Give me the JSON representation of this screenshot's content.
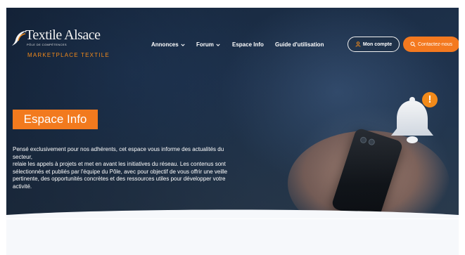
{
  "brand": {
    "logo_word": "Textile Alsace",
    "logo_sub": "PÔLE DE COMPÉTENCES",
    "logo_tag": "MARKETPLACE TEXTILE",
    "accent_color": "#f27a1e"
  },
  "nav": {
    "items": [
      {
        "label": "Annonces",
        "has_dropdown": true
      },
      {
        "label": "Forum",
        "has_dropdown": true
      },
      {
        "label": "Espace Info",
        "has_dropdown": false
      },
      {
        "label": "Guide d'utilisation",
        "has_dropdown": false
      }
    ],
    "account_label": "Mon compte",
    "account_icon": "user-icon",
    "contact_label": "Contactez-nous",
    "contact_icon": "search-icon"
  },
  "hero": {
    "title": "Espace Info",
    "description_lines": [
      "Pensé exclusivement pour nos adhérents, cet espace vous informe des actualités du",
      "secteur,",
      "relaie les appels à projets et met en avant les initiatives du réseau. Les contenus sont",
      "sélectionnés et publiés par l'équipe du Pôle, avec pour objectif de vous offrir une veille",
      "pertinente, des opportunités concrètes et des ressources utiles pour développer votre",
      "activité."
    ],
    "bell_icon": "bell-icon",
    "bell_badge": "!"
  }
}
